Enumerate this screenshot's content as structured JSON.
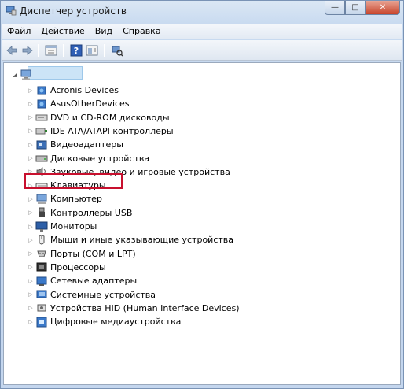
{
  "window": {
    "title": "Диспетчер устройств",
    "controls": {
      "minimize": "—",
      "maximize": "□",
      "close": "✕"
    }
  },
  "menubar": {
    "items": [
      {
        "label": "Файл",
        "accel": "Ф",
        "rest": "айл"
      },
      {
        "label": "Действие",
        "accel": "Д",
        "rest": "ействие"
      },
      {
        "label": "Вид",
        "accel": "В",
        "rest": "ид"
      },
      {
        "label": "Справка",
        "accel": "С",
        "rest": "правка"
      }
    ]
  },
  "toolbar": {
    "buttons": [
      "back-icon",
      "forward-icon",
      "properties-icon",
      "help-icon",
      "show-hide-icon",
      "scan-hardware-icon"
    ]
  },
  "tree": {
    "root_label": "",
    "items": [
      {
        "label": "Acronis Devices",
        "icon": "device-icon"
      },
      {
        "label": "AsusOtherDevices",
        "icon": "device-icon"
      },
      {
        "label": "DVD и CD-ROM дисководы",
        "icon": "dvd-icon"
      },
      {
        "label": "IDE ATA/ATAPI контроллеры",
        "icon": "ide-icon"
      },
      {
        "label": "Видеоадаптеры",
        "icon": "display-adapter-icon"
      },
      {
        "label": "Дисковые устройства",
        "icon": "disk-icon"
      },
      {
        "label": "Звуковые, видео и игровые устройства",
        "icon": "sound-icon"
      },
      {
        "label": "Клавиатуры",
        "icon": "keyboard-icon"
      },
      {
        "label": "Компьютер",
        "icon": "computer-icon"
      },
      {
        "label": "Контроллеры USB",
        "icon": "usb-icon"
      },
      {
        "label": "Мониторы",
        "icon": "monitor-icon"
      },
      {
        "label": "Мыши и иные указывающие устройства",
        "icon": "mouse-icon"
      },
      {
        "label": "Порты (COM и LPT)",
        "icon": "port-icon"
      },
      {
        "label": "Процессоры",
        "icon": "processor-icon"
      },
      {
        "label": "Сетевые адаптеры",
        "icon": "network-icon"
      },
      {
        "label": "Системные устройства",
        "icon": "system-icon"
      },
      {
        "label": "Устройства HID (Human Interface Devices)",
        "icon": "hid-icon"
      },
      {
        "label": "Цифровые медиаустройства",
        "icon": "media-icon"
      }
    ],
    "highlighted_item": "Клавиатуры",
    "highlight_color": "#c8102e"
  }
}
